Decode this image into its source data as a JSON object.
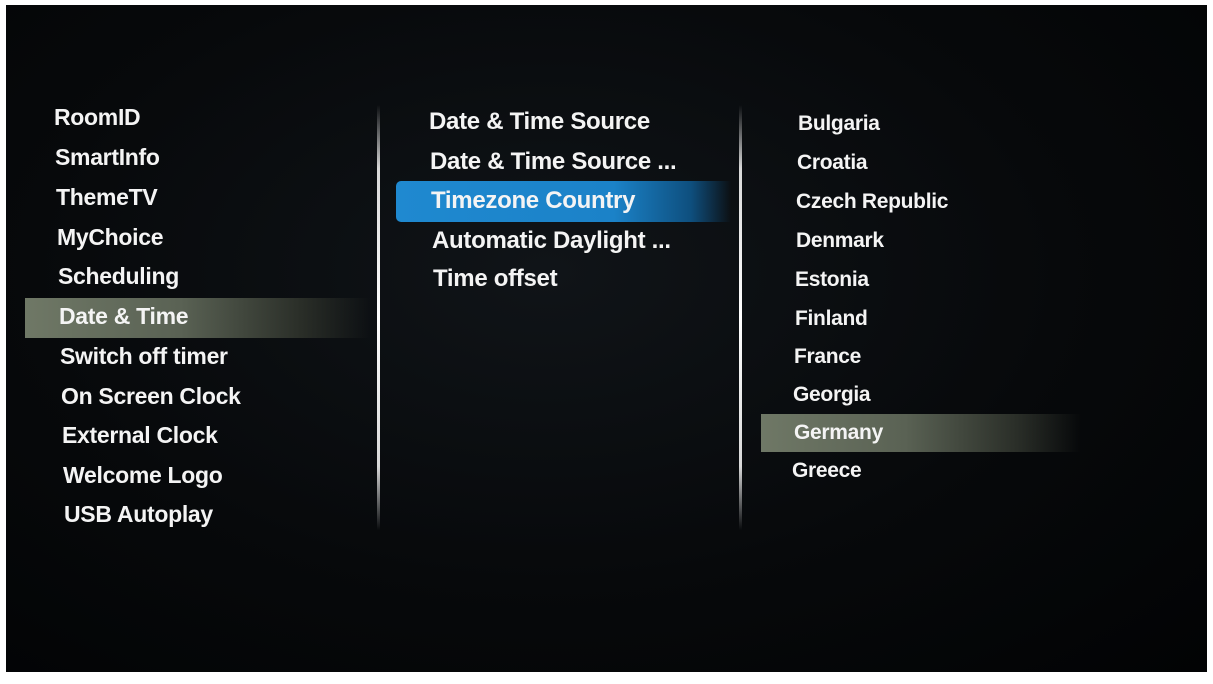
{
  "menu": {
    "items": [
      {
        "label": "RoomID"
      },
      {
        "label": "SmartInfo"
      },
      {
        "label": "ThemeTV"
      },
      {
        "label": "MyChoice"
      },
      {
        "label": "Scheduling"
      },
      {
        "label": "Date & Time"
      },
      {
        "label": "Switch off timer"
      },
      {
        "label": "On Screen Clock"
      },
      {
        "label": "External Clock"
      },
      {
        "label": "Welcome Logo"
      },
      {
        "label": "USB Autoplay"
      }
    ],
    "selected_index": 5
  },
  "submenu": {
    "items": [
      {
        "label": "Date & Time Source"
      },
      {
        "label": "Date & Time Source ..."
      },
      {
        "label": "Timezone Country"
      },
      {
        "label": "Automatic Daylight ..."
      },
      {
        "label": "Time offset"
      }
    ],
    "selected_index": 2
  },
  "countries": {
    "items": [
      {
        "label": "Bulgaria"
      },
      {
        "label": "Croatia"
      },
      {
        "label": "Czech Republic"
      },
      {
        "label": "Denmark"
      },
      {
        "label": "Estonia"
      },
      {
        "label": "Finland"
      },
      {
        "label": "France"
      },
      {
        "label": "Georgia"
      },
      {
        "label": "Germany"
      },
      {
        "label": "Greece"
      }
    ],
    "selected_index": 8
  },
  "colors": {
    "background": "#05070a",
    "text": "#f4f4f4",
    "selection_blue": "#1f89d0",
    "selection_grey": "#6f7866"
  }
}
